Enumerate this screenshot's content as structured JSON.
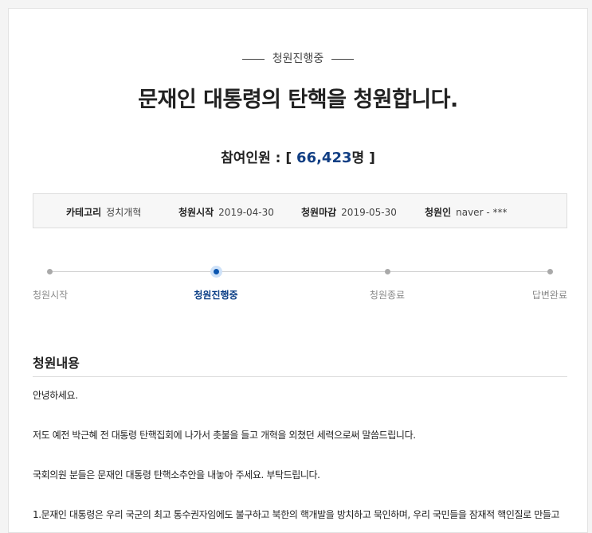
{
  "petition": {
    "status": "청원진행중",
    "title": "문재인 대통령의 탄핵을 청원합니다.",
    "participants": {
      "label": "참여인원 : [ ",
      "count": "66,423",
      "unit": "명 ]"
    },
    "meta": {
      "category_label": "카테고리",
      "category_value": "정치개혁",
      "start_label": "청원시작",
      "start_value": "2019-04-30",
      "end_label": "청원마감",
      "end_value": "2019-05-30",
      "author_label": "청원인",
      "author_value": "naver - ***"
    },
    "steps": [
      {
        "label": "청원시작",
        "active": false
      },
      {
        "label": "청원진행중",
        "active": true
      },
      {
        "label": "청원종료",
        "active": false
      },
      {
        "label": "답변완료",
        "active": false
      }
    ],
    "content": {
      "heading": "청원내용",
      "paragraphs": [
        "안녕하세요.",
        "저도 예전 박근혜 전 대통령 탄핵집회에 나가서 촛불을 들고 개혁을 외쳤던 세력으로써 말씀드립니다.",
        "국회의원 분들은 문재인 대통령 탄핵소추안을 내놓아 주세요. 부탁드립니다.",
        "1.문재인 대통령은 우리 국군의 최고 통수권자임에도 불구하고 북한의 핵개발을 방치하고 묵인하며, 우리 국민들을 잠재적 핵인질로 만들고"
      ]
    }
  },
  "colors": {
    "accent": "#123f84",
    "active_step": "#0b56b0",
    "inactive_step": "#a9a9a9"
  }
}
